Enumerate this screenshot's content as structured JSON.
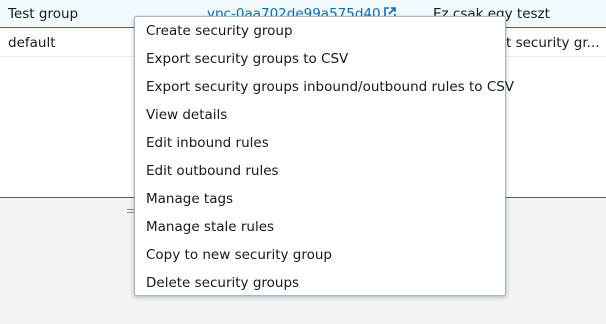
{
  "table": {
    "rows": [
      {
        "name": "Test group",
        "vpc_id": "vpc-0aa702de99a575d40",
        "description": "Ez csak egy teszt"
      },
      {
        "name": "default",
        "description": "t security gr..."
      }
    ]
  },
  "context_menu": {
    "items": [
      "Create security group",
      "Export security groups to CSV",
      "Export security groups inbound/outbound rules to CSV",
      "View details",
      "Edit inbound rules",
      "Edit outbound rules",
      "Manage tags",
      "Manage stale rules",
      "Copy to new security group",
      "Delete security groups"
    ]
  },
  "icons": {
    "vpc_link": "external-link-icon",
    "panel_handle": "resize-handle-icon"
  },
  "colors": {
    "link": "#0073bb",
    "selected_row_bg": "#f1faff",
    "selected_row_border": "#0073bb",
    "panel_bg": "#f2f3f3"
  }
}
